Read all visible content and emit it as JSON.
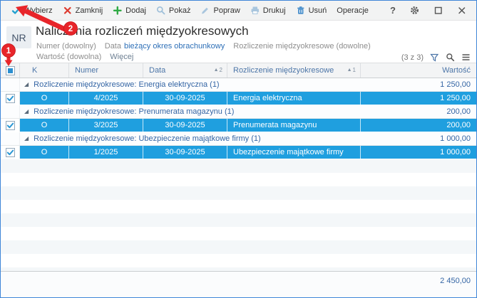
{
  "toolbar": {
    "buttons": {
      "wybierz": "Wybierz",
      "zamknij": "Zamknij",
      "dodaj": "Dodaj",
      "pokaz": "Pokaż",
      "popraw": "Popraw",
      "drukuj": "Drukuj",
      "usun": "Usuń",
      "operacje": "Operacje"
    },
    "help": "?"
  },
  "header": {
    "badge": "NR",
    "title": "Naliczenia rozliczeń międzyokresowych",
    "filters": {
      "numer": "Numer (dowolny)",
      "data_label": "Data",
      "data_value": "bieżący okres obrachunkowy",
      "rozliczenie": "Rozliczenie międzyokresowe (dowolne)",
      "wartosc": "Wartość (dowolna)",
      "wiecej": "Więcej"
    },
    "counter": "(3 z 3)"
  },
  "grid": {
    "columns": {
      "k": "K",
      "numer": "Numer",
      "data": "Data",
      "rozliczenie": "Rozliczenie międzyokresowe",
      "wartosc": "Wartość"
    },
    "sort_glyph": "▲",
    "expand_glyph": "◢",
    "sort_indicators": {
      "data": "2",
      "rozliczenie": "1"
    },
    "groups": [
      {
        "label": "Rozliczenie międzyokresowe: Energia elektryczna (1)",
        "value": "1 250,00",
        "row": {
          "k": "O",
          "numer": "4/2025",
          "data": "30-09-2025",
          "rozliczenie": "Energia elektryczna",
          "wartosc": "1 250,00"
        }
      },
      {
        "label": "Rozliczenie międzyokresowe: Prenumerata magazynu (1)",
        "value": "200,00",
        "row": {
          "k": "O",
          "numer": "3/2025",
          "data": "30-09-2025",
          "rozliczenie": "Prenumerata magazynu",
          "wartosc": "200,00"
        }
      },
      {
        "label": "Rozliczenie międzyokresowe: Ubezpieczenie majątkowe firmy (1)",
        "value": "1 000,00",
        "row": {
          "k": "O",
          "numer": "1/2025",
          "data": "30-09-2025",
          "rozliczenie": "Ubezpieczenie majątkowe firmy",
          "wartosc": "1 000,00"
        }
      }
    ],
    "total": "2 450,00"
  },
  "annotations": {
    "step1": "1",
    "step2": "2"
  },
  "colors": {
    "selected_row": "#1f9fdf",
    "accent_blue": "#3465a4",
    "link_blue": "#2d6fb7",
    "annotation_red": "#e8252a",
    "window_border": "#3f86d8"
  }
}
